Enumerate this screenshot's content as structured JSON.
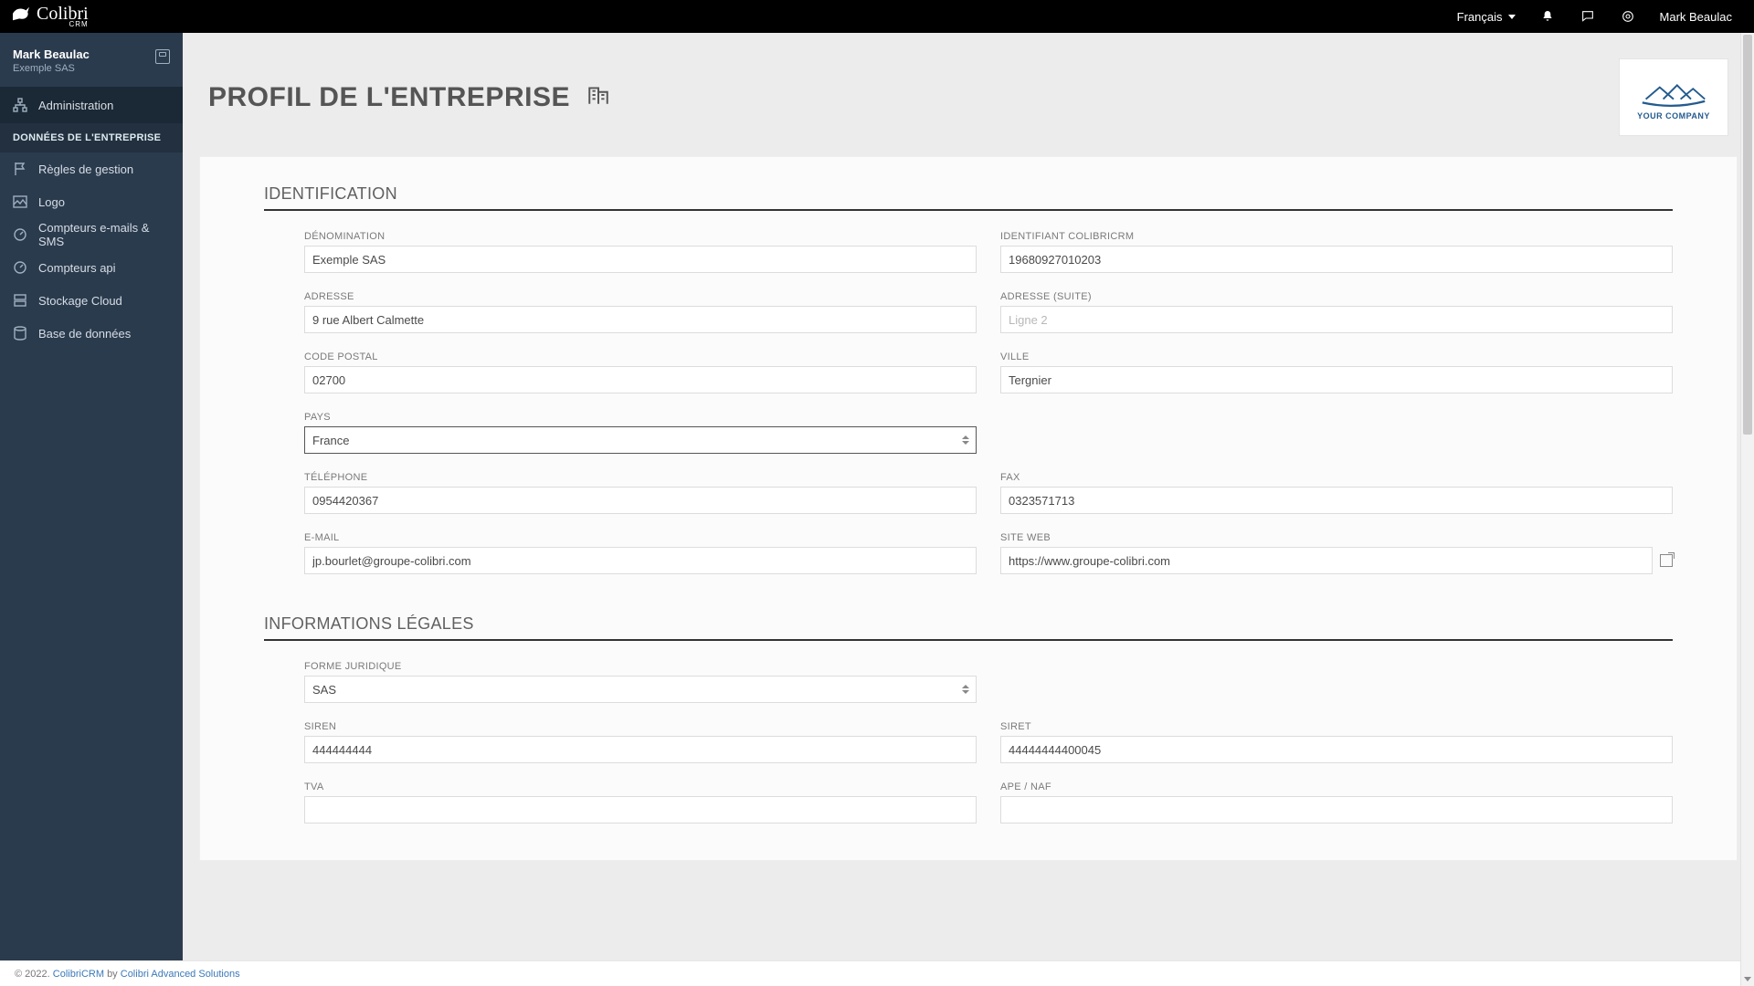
{
  "brand": {
    "name": "Colibri",
    "sub": "CRM"
  },
  "topbar": {
    "language": "Français",
    "user": "Mark Beaulac"
  },
  "sidebar": {
    "user": {
      "name": "Mark Beaulac",
      "company": "Exemple SAS"
    },
    "admin_label": "Administration",
    "section_label": "DONNÉES DE L'ENTREPRISE",
    "items": [
      {
        "label": "Règles de gestion"
      },
      {
        "label": "Logo"
      },
      {
        "label": "Compteurs e-mails & SMS"
      },
      {
        "label": "Compteurs api"
      },
      {
        "label": "Stockage Cloud"
      },
      {
        "label": "Base de données"
      }
    ]
  },
  "page": {
    "title": "PROFIL DE L'ENTREPRISE",
    "company_logo_text": "YOUR COMPANY"
  },
  "sections": {
    "identification": "IDENTIFICATION",
    "legal": "INFORMATIONS LÉGALES"
  },
  "fields": {
    "denomination": {
      "label": "DÉNOMINATION",
      "value": "Exemple SAS"
    },
    "colibri_id": {
      "label": "IDENTIFIANT COLIBRICRM",
      "value": "19680927010203"
    },
    "address": {
      "label": "ADRESSE",
      "value": "9 rue Albert Calmette"
    },
    "address2": {
      "label": "ADRESSE (SUITE)",
      "value": "",
      "placeholder": "Ligne 2"
    },
    "postal": {
      "label": "CODE POSTAL",
      "value": "02700"
    },
    "city": {
      "label": "VILLE",
      "value": "Tergnier"
    },
    "country": {
      "label": "PAYS",
      "value": "France"
    },
    "phone": {
      "label": "TÉLÉPHONE",
      "value": "0954420367"
    },
    "fax": {
      "label": "FAX",
      "value": "0323571713"
    },
    "email": {
      "label": "E-MAIL",
      "value": "jp.bourlet@groupe-colibri.com"
    },
    "website": {
      "label": "SITE WEB",
      "value": "https://www.groupe-colibri.com"
    },
    "legal_form": {
      "label": "FORME JURIDIQUE",
      "value": "SAS"
    },
    "siren": {
      "label": "SIREN",
      "value": "444444444"
    },
    "siret": {
      "label": "SIRET",
      "value": "44444444400045"
    },
    "tva": {
      "label": "TVA",
      "value": ""
    },
    "ape": {
      "label": "APE / NAF",
      "value": ""
    }
  },
  "footer": {
    "copyright": "© 2022.",
    "product": "ColibriCRM",
    "by": "by",
    "company": "Colibri Advanced Solutions"
  }
}
